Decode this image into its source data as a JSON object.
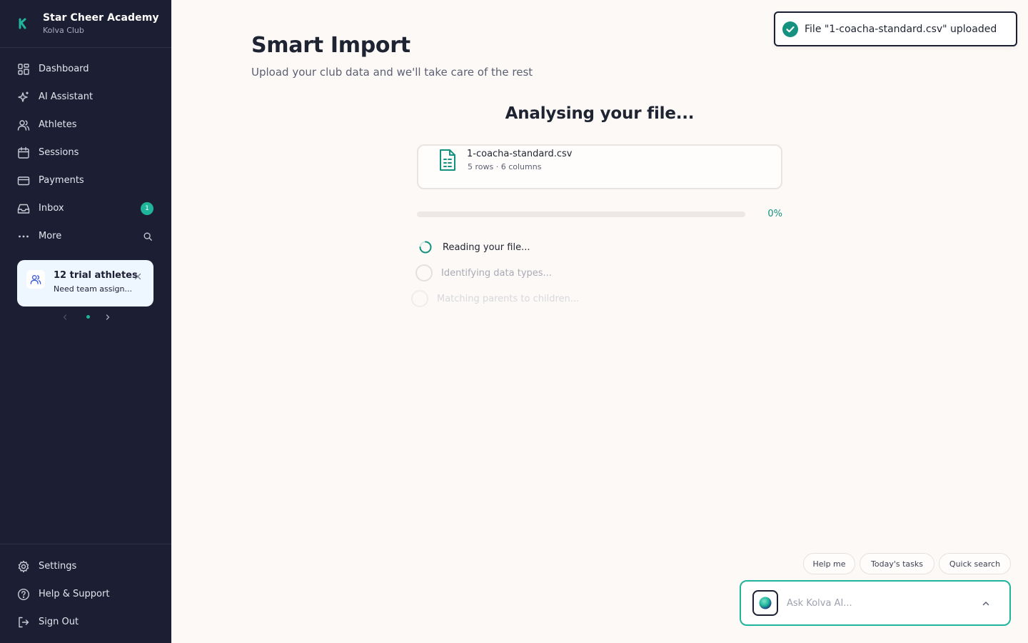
{
  "brand": {
    "name": "Star Cheer Academy",
    "sub": "Kolva Club"
  },
  "nav": {
    "dashboard": "Dashboard",
    "ai_assistant": "AI Assistant",
    "athletes": "Athletes",
    "sessions": "Sessions",
    "payments": "Payments",
    "inbox": "Inbox",
    "inbox_badge": "1",
    "more": "More"
  },
  "promo": {
    "title": "12 trial athletes",
    "sub": "Need team assign..."
  },
  "bottom_nav": {
    "settings": "Settings",
    "help": "Help & Support",
    "sign_out": "Sign Out"
  },
  "page": {
    "title": "Smart Import",
    "subtitle": "Upload your club data and we'll take care of the rest"
  },
  "analysis": {
    "heading": "Analysing your file...",
    "file_name": "1-coacha-standard.csv",
    "file_meta": "5 rows · 6 columns",
    "progress": 0,
    "progress_label": "0%",
    "steps": [
      "Reading your file...",
      "Identifying data types...",
      "Matching parents to children..."
    ]
  },
  "toast": {
    "text": "File \"1-coacha-standard.csv\" uploaded"
  },
  "quick_actions": {
    "help": "Help me",
    "tasks": "Today's tasks",
    "search": "Quick search"
  },
  "ask": {
    "placeholder": "Ask Kolva AI..."
  },
  "colors": {
    "sidebar": "#1c1f33",
    "accent": "#1fb59c",
    "background": "#fdf9f6"
  }
}
